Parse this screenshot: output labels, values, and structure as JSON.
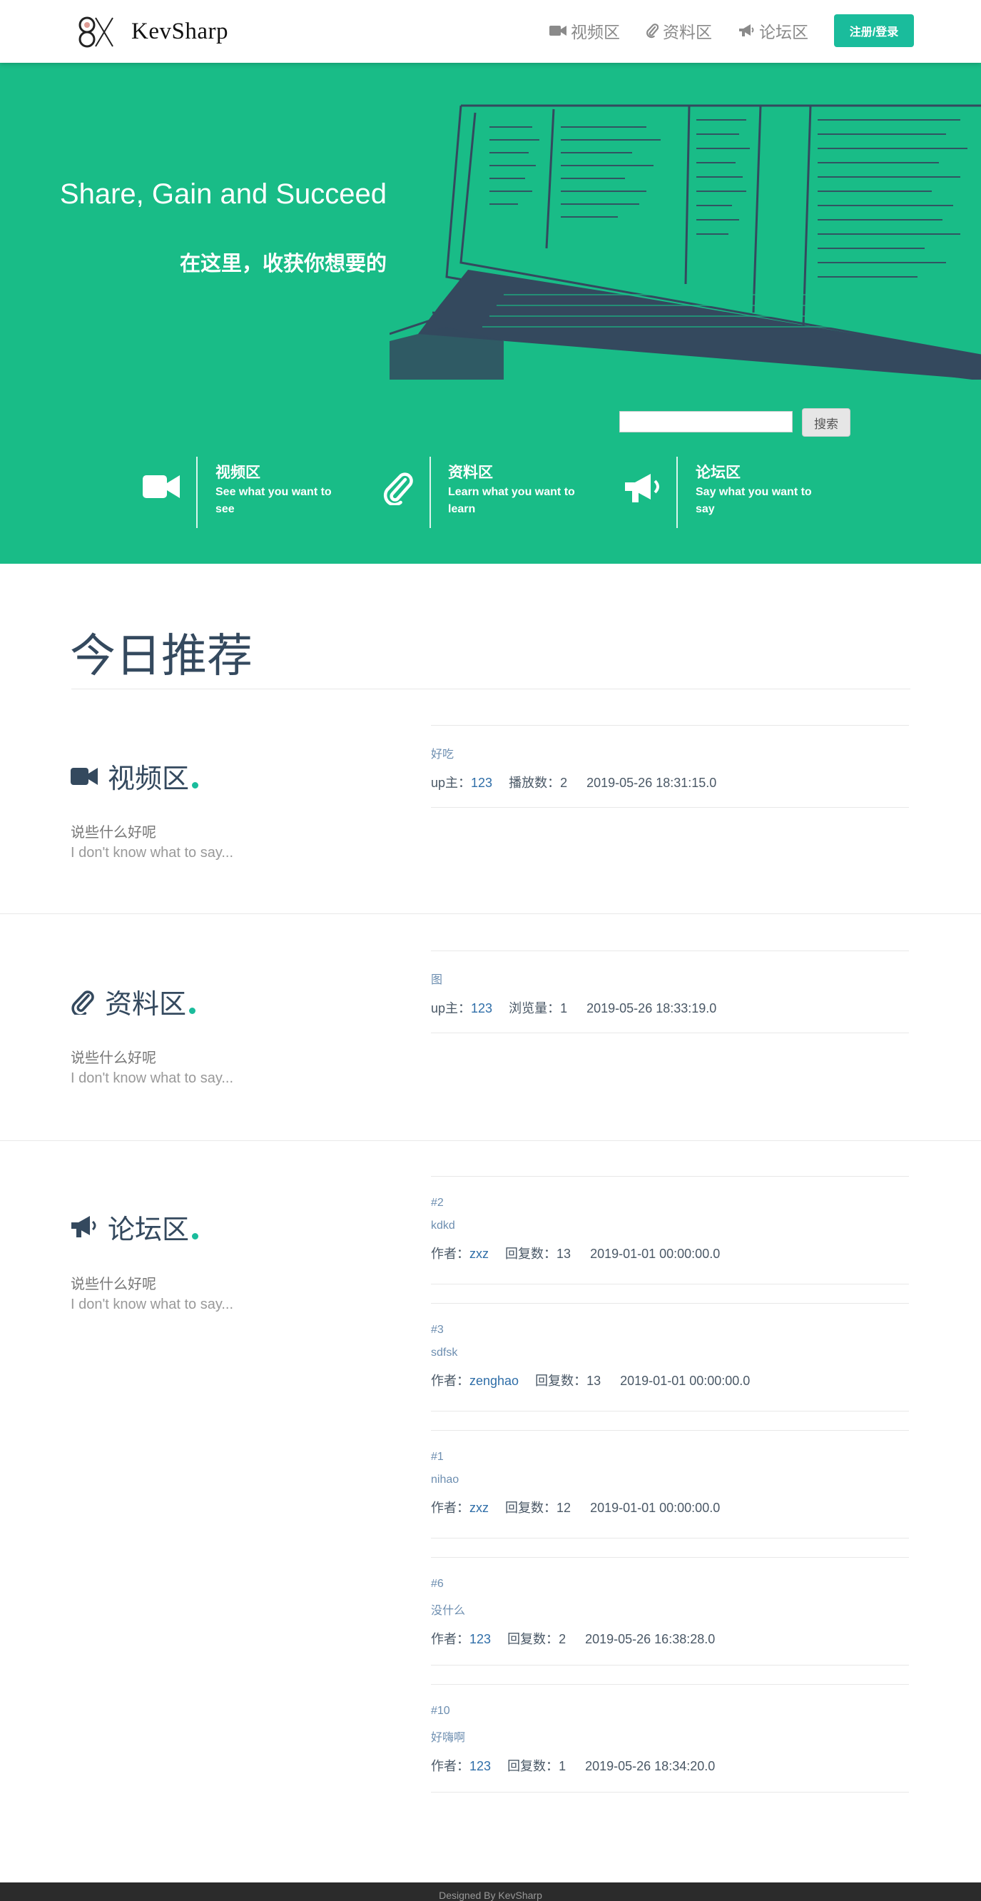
{
  "brand": {
    "name": "KevSharp"
  },
  "nav": {
    "video": "视频区",
    "docs": "资料区",
    "forum": "论坛区",
    "login": "注册/登录"
  },
  "hero": {
    "title": "Share, Gain and Succeed",
    "subtitle": "在这里，收获你想要的",
    "search_button": "搜索",
    "search_value": ""
  },
  "features": [
    {
      "title": "视频区",
      "desc": "See what you want to see",
      "icon": "video-camera-icon"
    },
    {
      "title": "资料区",
      "desc": "Learn what you want to learn",
      "icon": "paperclip-icon"
    },
    {
      "title": "论坛区",
      "desc": "Say what you want to say",
      "icon": "megaphone-icon"
    }
  ],
  "today": {
    "title": "今日推荐"
  },
  "sections": {
    "video": {
      "title": "视频区",
      "line1": "说些什么好呢",
      "line2": "I don't know what to say...",
      "items": [
        {
          "title": "好吃",
          "author_label": "up主：",
          "author": "123",
          "count_label": "播放数：",
          "count": "2",
          "time": "2019-05-26 18:31:15.0"
        }
      ]
    },
    "docs": {
      "title": "资料区",
      "line1": "说些什么好呢",
      "line2": "I don't know what to say...",
      "items": [
        {
          "title": "图",
          "author_label": "up主：",
          "author": "123",
          "count_label": "浏览量：",
          "count": "1",
          "time": "2019-05-26 18:33:19.0"
        }
      ]
    },
    "forum": {
      "title": "论坛区",
      "line1": "说些什么好呢",
      "line2": "I don't know what to say...",
      "items": [
        {
          "id": "#2",
          "title": "kdkd",
          "author_label": "作者：",
          "author": "zxz",
          "count_label": "回复数：",
          "count": "13",
          "time": "2019-01-01 00:00:00.0"
        },
        {
          "id": "#3",
          "title": "sdfsk",
          "author_label": "作者：",
          "author": "zenghao",
          "count_label": "回复数：",
          "count": "13",
          "time": "2019-01-01 00:00:00.0"
        },
        {
          "id": "#1",
          "title": "nihao",
          "author_label": "作者：",
          "author": "zxz",
          "count_label": "回复数：",
          "count": "12",
          "time": "2019-01-01 00:00:00.0"
        },
        {
          "id": "#6",
          "title": "没什么",
          "author_label": "作者：",
          "author": "123",
          "count_label": "回复数：",
          "count": "2",
          "time": "2019-05-26 16:38:28.0"
        },
        {
          "id": "#10",
          "title": "好嗨啊",
          "author_label": "作者：",
          "author": "123",
          "count_label": "回复数：",
          "count": "1",
          "time": "2019-05-26 18:34:20.0"
        }
      ]
    }
  },
  "footer": {
    "text": "Designed By KevSharp"
  },
  "colors": {
    "accent": "#1abc9c",
    "hero": "#19bc87",
    "heading": "#34495e",
    "link": "#2f6ea8"
  }
}
